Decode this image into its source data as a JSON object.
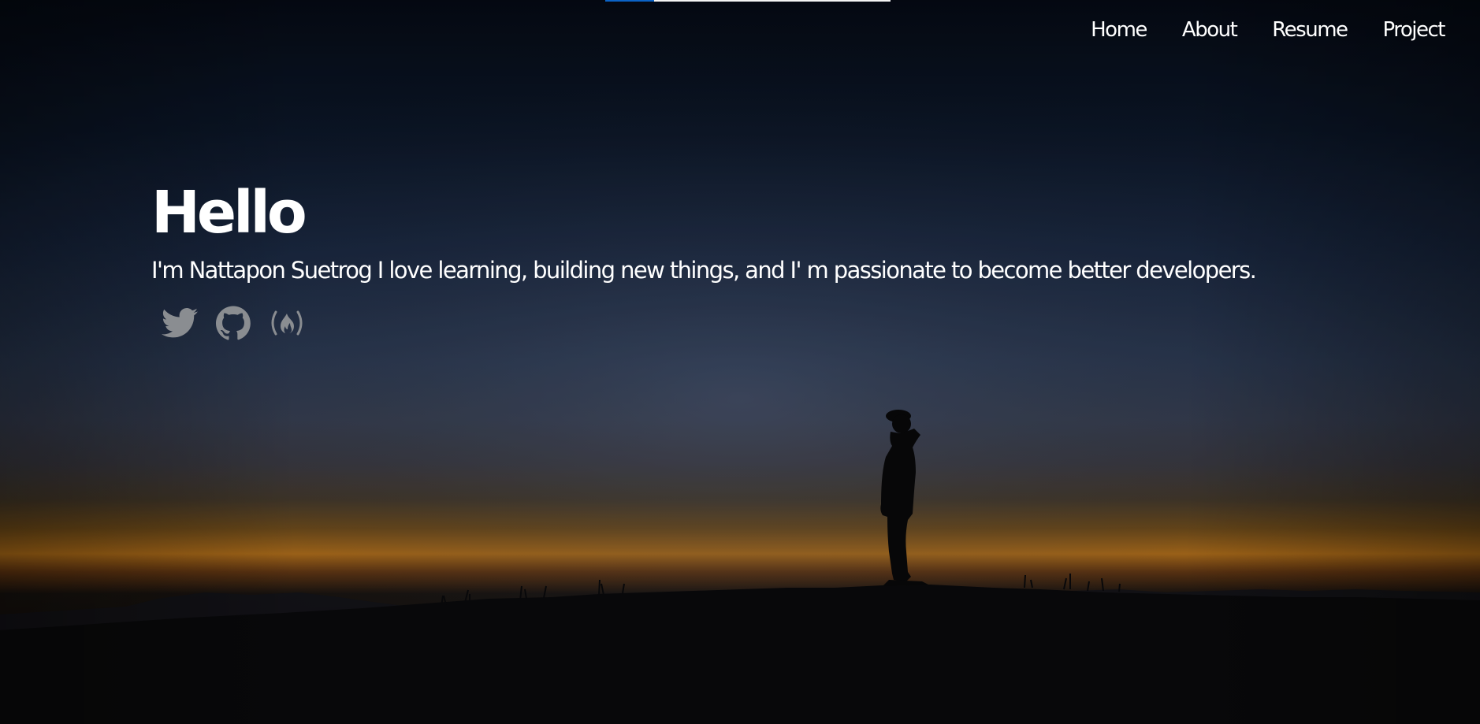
{
  "nav": {
    "items": [
      {
        "label": "Home"
      },
      {
        "label": "About"
      },
      {
        "label": "Resume"
      },
      {
        "label": "Project"
      }
    ]
  },
  "scroll_progress": 0.17,
  "hero": {
    "title": "Hello",
    "tagline": "I'm Nattapon Suetrog I love learning, building new things, and I' m passionate to become better developers."
  },
  "social": [
    {
      "icon": "twitter-icon"
    },
    {
      "icon": "github-icon"
    },
    {
      "icon": "freecodecamp-icon"
    }
  ],
  "colors": {
    "nav_text": "#ffffff",
    "title_text": "#ffffff",
    "social_icon": "#8a8d91",
    "progress_fill": "#0b63c6",
    "progress_track": "#f4f4f4",
    "sky_top": "#050a14",
    "sky_mid": "#2b3c5c",
    "horizon_glow": "#d98a1c"
  }
}
